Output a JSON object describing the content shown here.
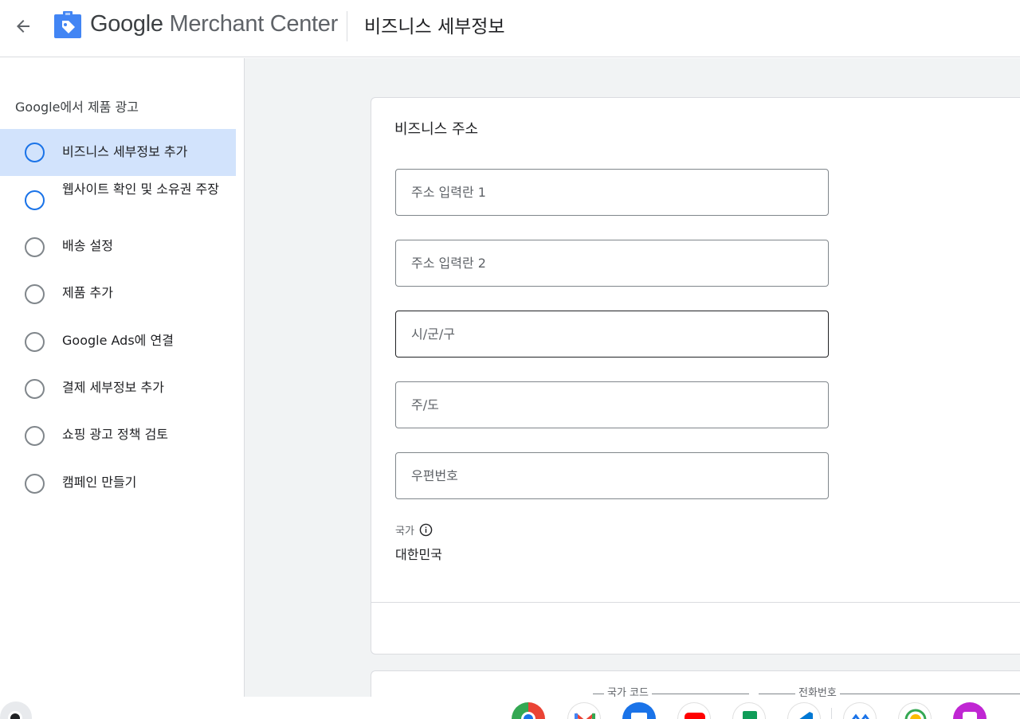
{
  "header": {
    "brand_google": "Google",
    "brand_rest": " Merchant Center",
    "page_title": "비즈니스 세부정보"
  },
  "sidebar": {
    "heading": "Google에서 제품 광고",
    "steps": [
      {
        "label": "비즈니스 세부정보 추가",
        "state": "active"
      },
      {
        "label": "웹사이트 확인 및 소유권 주장",
        "state": "in-progress"
      },
      {
        "label": "배송 설정",
        "state": "todo"
      },
      {
        "label": "제품 추가",
        "state": "todo"
      },
      {
        "label": "Google Ads에 연결",
        "state": "todo"
      },
      {
        "label": "결제 세부정보 추가",
        "state": "todo"
      },
      {
        "label": "쇼핑 광고 정책 검토",
        "state": "todo"
      },
      {
        "label": "캠페인 만들기",
        "state": "todo"
      }
    ]
  },
  "address_card": {
    "title": "비즈니스 주소",
    "fields": {
      "address1": {
        "value": "",
        "placeholder": "주소 입력란 1"
      },
      "address2": {
        "value": "",
        "placeholder": "주소 입력란 2"
      },
      "city": {
        "value": "",
        "placeholder": "시/군/구"
      },
      "state": {
        "value": "",
        "placeholder": "주/도"
      },
      "postal": {
        "value": "",
        "placeholder": "우편번호"
      }
    },
    "country_label": "국가",
    "country_value": "대한민국"
  },
  "phone_card": {
    "country_code_label": "국가 코드",
    "phone_label": "전화번호"
  },
  "colors": {
    "accent": "#1a73e8",
    "active_bg": "#d2e3fc",
    "main_bg": "#f1f3f4"
  },
  "icons": {
    "back": "arrow-left-icon",
    "logo": "merchant-tag-icon",
    "info": "info-icon"
  }
}
